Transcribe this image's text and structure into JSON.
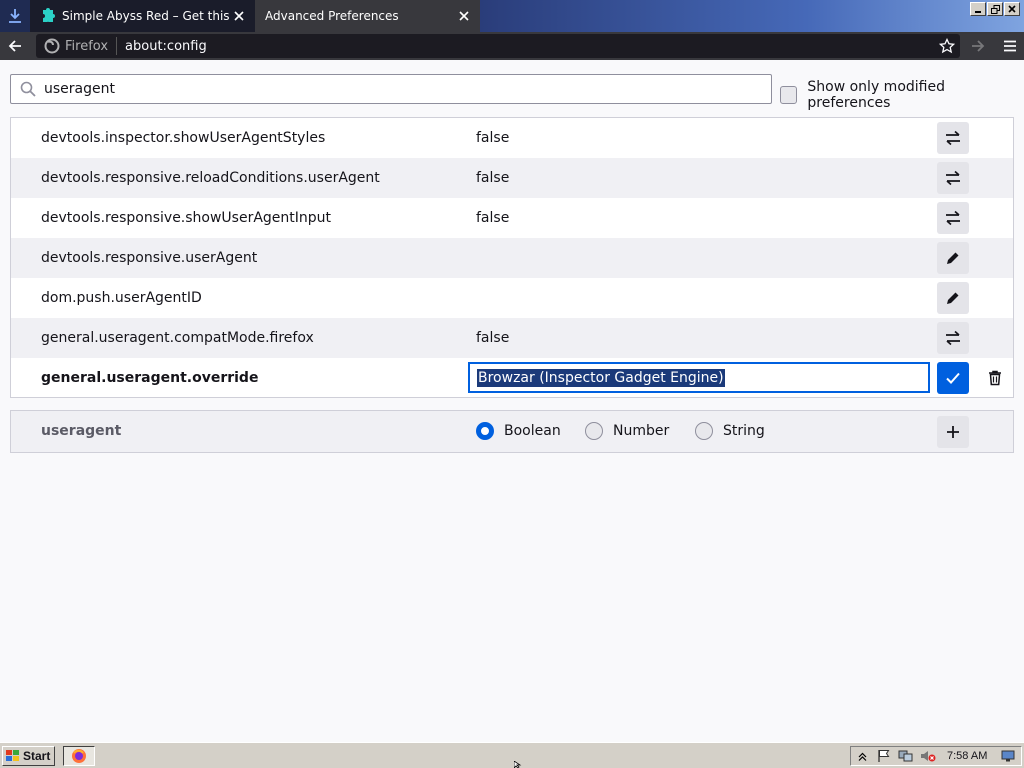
{
  "tabs": [
    {
      "title": "Simple Abyss Red – Get this Theme",
      "icon": "puzzle-icon",
      "active": false
    },
    {
      "title": "Advanced Preferences",
      "icon": "none",
      "active": true
    }
  ],
  "navbar": {
    "identity_label": "Firefox",
    "url": "about:config"
  },
  "search": {
    "value": "useragent"
  },
  "modified_filter": {
    "label": "Show only modified preferences",
    "checked": false
  },
  "prefs": [
    {
      "name": "devtools.inspector.showUserAgentStyles",
      "value": "false",
      "action": "toggle-icon"
    },
    {
      "name": "devtools.responsive.reloadConditions.userAgent",
      "value": "false",
      "action": "toggle-icon"
    },
    {
      "name": "devtools.responsive.showUserAgentInput",
      "value": "false",
      "action": "toggle-icon"
    },
    {
      "name": "devtools.responsive.userAgent",
      "value": "",
      "action": "pencil-icon"
    },
    {
      "name": "dom.push.userAgentID",
      "value": "",
      "action": "pencil-icon"
    },
    {
      "name": "general.useragent.compatMode.firefox",
      "value": "false",
      "action": "toggle-icon"
    },
    {
      "name": "general.useragent.override",
      "value": "Browzar (Inspector Gadget Engine)",
      "action": "save-icon",
      "editing": true
    }
  ],
  "add_row": {
    "name": "useragent",
    "types": [
      "Boolean",
      "Number",
      "String"
    ],
    "selected_type": "Boolean"
  },
  "taskbar": {
    "start_label": "Start",
    "clock": "7:58 AM"
  },
  "colors": {
    "accent": "#0060df",
    "tabstrip": "#1f2b52",
    "toolbar": "#38383d"
  }
}
